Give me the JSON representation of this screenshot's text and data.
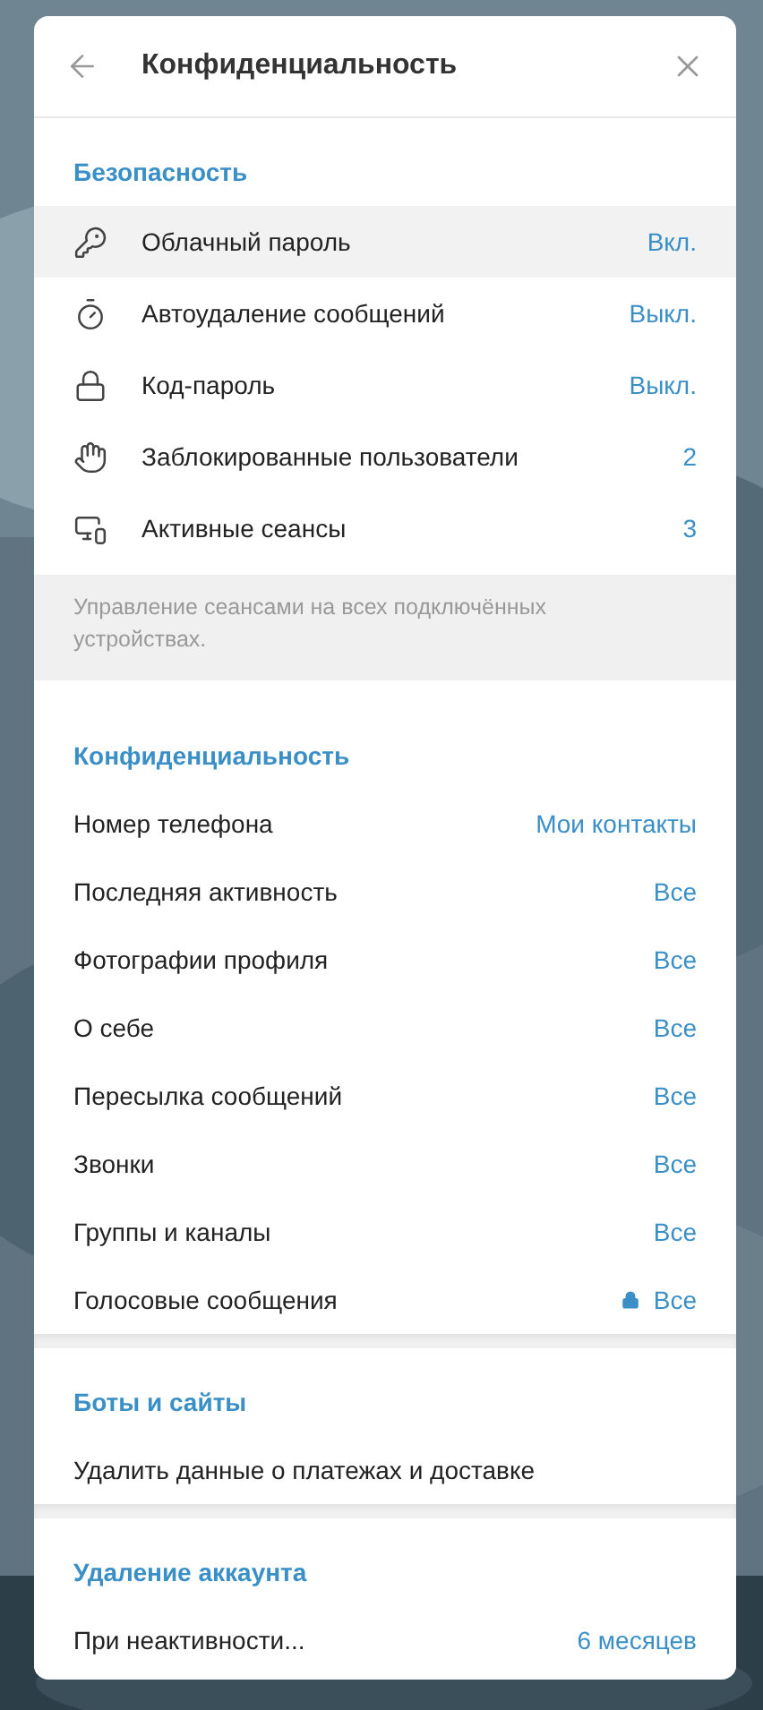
{
  "header": {
    "title": "Конфиденциальность"
  },
  "sections": [
    {
      "title": "Безопасность",
      "rows": [
        {
          "kind": "key",
          "label": "Облачный пароль",
          "value": "Вкл.",
          "highlighted": true
        },
        {
          "kind": "timer",
          "label": "Автоудаление сообщений",
          "value": "Выкл.",
          "highlighted": false
        },
        {
          "kind": "lock",
          "label": "Код-пароль",
          "value": "Выкл.",
          "highlighted": false
        },
        {
          "kind": "hand",
          "label": "Заблокированные пользователи",
          "value": "2",
          "highlighted": false
        },
        {
          "kind": "devices",
          "label": "Активные сеансы",
          "value": "3",
          "highlighted": false
        }
      ],
      "note": "Управление сеансами на всех подключённых устройствах."
    },
    {
      "title": "Конфиденциальность",
      "rows": [
        {
          "label": "Номер телефона",
          "value": "Мои контакты",
          "locked": false
        },
        {
          "label": "Последняя активность",
          "value": "Все",
          "locked": false
        },
        {
          "label": "Фотографии профиля",
          "value": "Все",
          "locked": false
        },
        {
          "label": "О себе",
          "value": "Все",
          "locked": false
        },
        {
          "label": "Пересылка сообщений",
          "value": "Все",
          "locked": false
        },
        {
          "label": "Звонки",
          "value": "Все",
          "locked": false
        },
        {
          "label": "Группы и каналы",
          "value": "Все",
          "locked": false
        },
        {
          "label": "Голосовые сообщения",
          "value": "Все",
          "locked": true
        }
      ]
    },
    {
      "title": "Боты и сайты",
      "rows": [
        {
          "label": "Удалить данные о платежах и доставке"
        }
      ]
    },
    {
      "title": "Удаление аккаунта",
      "rows": [
        {
          "label": "При неактивности...",
          "value": "6 месяцев"
        }
      ]
    }
  ]
}
